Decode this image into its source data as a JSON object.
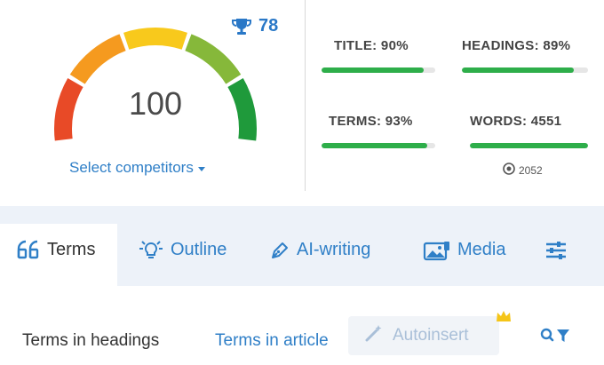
{
  "score": {
    "value": "100",
    "trophy_count": "78",
    "select_competitors": "Select competitors"
  },
  "metrics": {
    "title": {
      "label": "TITLE: 90%",
      "progress": 0.9
    },
    "headings": {
      "label": "HEADINGS: 89%",
      "progress": 0.89
    },
    "terms": {
      "label": "TERMS: 93%",
      "progress": 0.93
    },
    "words": {
      "label": "WORDS: 4551",
      "progress": 1.0,
      "sub_count": "2052"
    }
  },
  "tabs": [
    {
      "label": "Terms",
      "icon": "quote-icon",
      "active": true
    },
    {
      "label": "Outline",
      "icon": "lightbulb-icon",
      "active": false
    },
    {
      "label": "AI-writing",
      "icon": "pen-icon",
      "active": false
    },
    {
      "label": "Media",
      "icon": "image-icon",
      "active": false
    },
    {
      "label": "",
      "icon": "sliders-icon",
      "active": false
    }
  ],
  "subtabs": {
    "active": "Terms in headings",
    "other": "Terms in article",
    "autoinsert": "Autoinsert"
  },
  "colors": {
    "accent": "#2f7fc7",
    "bar_fill": "#2eae4a",
    "gauge_segments": [
      "#e84a27",
      "#f59a1f",
      "#f8c91c",
      "#86b83a",
      "#1f9a3b"
    ]
  }
}
